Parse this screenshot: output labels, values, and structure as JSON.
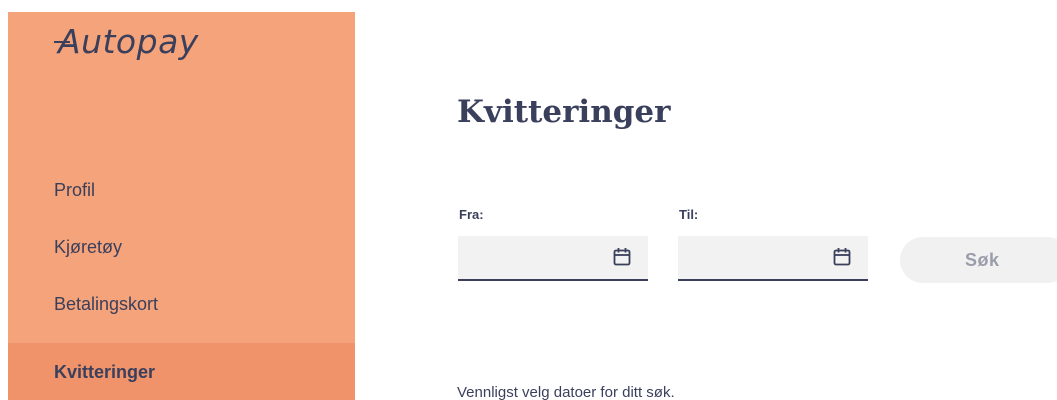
{
  "sidebar": {
    "logo_text": "Autopay",
    "items": [
      {
        "label": "Profil",
        "active": false
      },
      {
        "label": "Kjøretøy",
        "active": false
      },
      {
        "label": "Betalingskort",
        "active": false
      },
      {
        "label": "Kvitteringer",
        "active": true
      }
    ]
  },
  "main": {
    "title": "Kvitteringer",
    "from_label": "Fra:",
    "from_value": "",
    "to_label": "Til:",
    "to_value": "",
    "search_label": "Søk",
    "hint": "Vennligst velg datoer for ditt søk."
  },
  "colors": {
    "sidebar_bg": "#f5a37a",
    "sidebar_active_bg": "#f0936a",
    "text_primary": "#3a3f5c",
    "field_bg": "#f2f2f2",
    "button_bg": "#f1f1f1",
    "button_text_disabled": "#9b9daa"
  },
  "icons": {
    "date_picker": "calendar-icon"
  }
}
